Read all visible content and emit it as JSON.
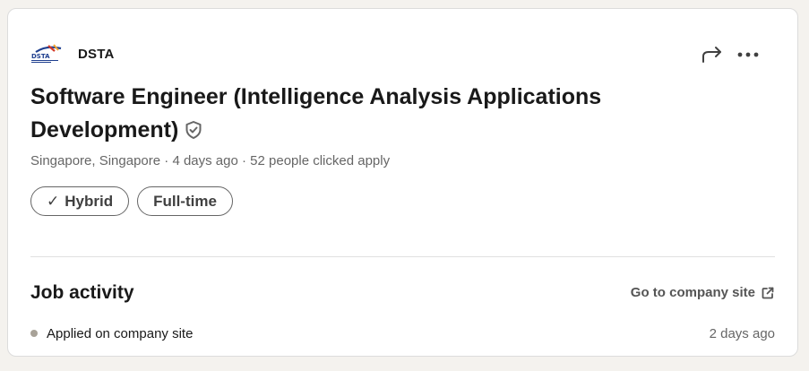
{
  "company": {
    "name": "DSTA",
    "logo_text": "DSTA",
    "logo_icon": "dsta-logo"
  },
  "actions": {
    "share_icon": "share-arrow-icon",
    "more_icon": "more-horizontal-icon"
  },
  "job": {
    "title": "Software Engineer (Intelligence Analysis Applications Development)",
    "verified_icon": "shield-check-icon",
    "meta": "Singapore, Singapore · 4 days ago · 52 people clicked apply",
    "pills": [
      {
        "label": "Hybrid",
        "check": "✓"
      },
      {
        "label": "Full-time"
      }
    ]
  },
  "activity": {
    "title": "Job activity",
    "company_link": "Go to company site",
    "entries": [
      {
        "label": "Applied on company site",
        "time": "2 days ago",
        "dot_color": "#a8a298"
      }
    ]
  }
}
